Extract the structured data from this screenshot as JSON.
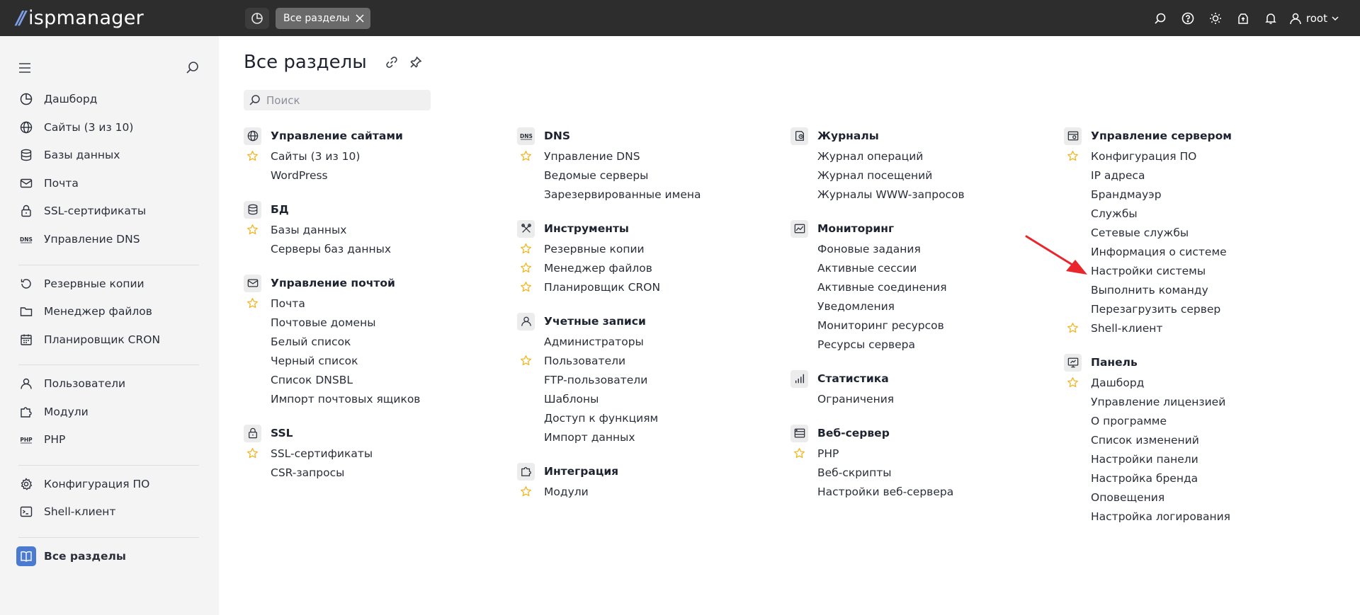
{
  "topbar": {
    "logo_mark": "//",
    "logo_text": "ispmanager",
    "tab_label": "Все разделы",
    "user": "root"
  },
  "sidebar": {
    "items": [
      {
        "label": "Дашборд",
        "icon": "dashboard-icon"
      },
      {
        "label": "Сайты (3 из 10)",
        "icon": "globe-icon"
      },
      {
        "label": "Базы данных",
        "icon": "database-icon"
      },
      {
        "label": "Почта",
        "icon": "mail-icon"
      },
      {
        "label": "SSL-сертификаты",
        "icon": "lock-icon"
      },
      {
        "label": "Управление DNS",
        "icon": "dns-icon"
      },
      {
        "label": "Резервные копии",
        "icon": "backup-icon"
      },
      {
        "label": "Менеджер файлов",
        "icon": "folder-icon"
      },
      {
        "label": "Планировщик CRON",
        "icon": "calendar-icon"
      },
      {
        "label": "Пользователи",
        "icon": "user-icon"
      },
      {
        "label": "Модули",
        "icon": "puzzle-icon"
      },
      {
        "label": "PHP",
        "icon": "php-icon"
      },
      {
        "label": "Конфигурация ПО",
        "icon": "gear-icon"
      },
      {
        "label": "Shell-клиент",
        "icon": "terminal-icon"
      },
      {
        "label": "Все разделы",
        "icon": "book-icon"
      }
    ]
  },
  "main": {
    "title": "Все разделы",
    "search_placeholder": "Поиск",
    "columns": [
      {
        "groups": [
          {
            "title": "Управление сайтами",
            "icon": "globe-icon",
            "links": [
              {
                "label": "Сайты (3 из 10)",
                "starred": true
              },
              {
                "label": "WordPress",
                "starred": false
              }
            ]
          },
          {
            "title": "БД",
            "icon": "database-icon",
            "links": [
              {
                "label": "Базы данных",
                "starred": true
              },
              {
                "label": "Серверы баз данных",
                "starred": false
              }
            ]
          },
          {
            "title": "Управление почтой",
            "icon": "mail-icon",
            "links": [
              {
                "label": "Почта",
                "starred": true
              },
              {
                "label": "Почтовые домены",
                "starred": false
              },
              {
                "label": "Белый список",
                "starred": false
              },
              {
                "label": "Черный список",
                "starred": false
              },
              {
                "label": "Список DNSBL",
                "starred": false
              },
              {
                "label": "Импорт почтовых ящиков",
                "starred": false
              }
            ]
          },
          {
            "title": "SSL",
            "icon": "lock-icon",
            "links": [
              {
                "label": "SSL-сертификаты",
                "starred": true
              },
              {
                "label": "CSR-запросы",
                "starred": false
              }
            ]
          }
        ]
      },
      {
        "groups": [
          {
            "title": "DNS",
            "icon": "dns-icon",
            "links": [
              {
                "label": "Управление DNS",
                "starred": true
              },
              {
                "label": "Ведомые серверы",
                "starred": false
              },
              {
                "label": "Зарезервированные имена",
                "starred": false
              }
            ]
          },
          {
            "title": "Инструменты",
            "icon": "tools-icon",
            "links": [
              {
                "label": "Резервные копии",
                "starred": true
              },
              {
                "label": "Менеджер файлов",
                "starred": true
              },
              {
                "label": "Планировщик CRON",
                "starred": true
              }
            ]
          },
          {
            "title": "Учетные записи",
            "icon": "user-icon",
            "links": [
              {
                "label": "Администраторы",
                "starred": false
              },
              {
                "label": "Пользователи",
                "starred": true
              },
              {
                "label": "FTP-пользователи",
                "starred": false
              },
              {
                "label": "Шаблоны",
                "starred": false
              },
              {
                "label": "Доступ к функциям",
                "starred": false
              },
              {
                "label": "Импорт данных",
                "starred": false
              }
            ]
          },
          {
            "title": "Интеграция",
            "icon": "puzzle-icon",
            "links": [
              {
                "label": "Модули",
                "starred": true
              }
            ]
          }
        ]
      },
      {
        "groups": [
          {
            "title": "Журналы",
            "icon": "log-icon",
            "links": [
              {
                "label": "Журнал операций",
                "starred": false
              },
              {
                "label": "Журнал посещений",
                "starred": false
              },
              {
                "label": "Журналы WWW-запросов",
                "starred": false
              }
            ]
          },
          {
            "title": "Мониторинг",
            "icon": "monitoring-icon",
            "links": [
              {
                "label": "Фоновые задания",
                "starred": false
              },
              {
                "label": "Активные сессии",
                "starred": false
              },
              {
                "label": "Активные соединения",
                "starred": false
              },
              {
                "label": "Уведомления",
                "starred": false
              },
              {
                "label": "Мониторинг ресурсов",
                "starred": false
              },
              {
                "label": "Ресурсы сервера",
                "starred": false
              }
            ]
          },
          {
            "title": "Статистика",
            "icon": "stats-icon",
            "links": [
              {
                "label": "Ограничения",
                "starred": false
              }
            ]
          },
          {
            "title": "Веб-сервер",
            "icon": "webserver-icon",
            "links": [
              {
                "label": "PHP",
                "starred": true
              },
              {
                "label": "Веб-скрипты",
                "starred": false
              },
              {
                "label": "Настройки веб-сервера",
                "starred": false
              }
            ]
          }
        ]
      },
      {
        "groups": [
          {
            "title": "Управление сервером",
            "icon": "server-icon",
            "links": [
              {
                "label": "Конфигурация ПО",
                "starred": true
              },
              {
                "label": "IP адреса",
                "starred": false
              },
              {
                "label": "Брандмауэр",
                "starred": false
              },
              {
                "label": "Службы",
                "starred": false
              },
              {
                "label": "Сетевые службы",
                "starred": false
              },
              {
                "label": "Информация о системе",
                "starred": false
              },
              {
                "label": "Настройки системы",
                "starred": false
              },
              {
                "label": "Выполнить команду",
                "starred": false
              },
              {
                "label": "Перезагрузить сервер",
                "starred": false
              },
              {
                "label": "Shell-клиент",
                "starred": true
              }
            ]
          },
          {
            "title": "Панель",
            "icon": "panel-icon",
            "links": [
              {
                "label": "Дашборд",
                "starred": true
              },
              {
                "label": "Управление лицензией",
                "starred": false
              },
              {
                "label": "О программе",
                "starred": false
              },
              {
                "label": "Список изменений",
                "starred": false
              },
              {
                "label": "Настройки панели",
                "starred": false
              },
              {
                "label": "Настройка бренда",
                "starred": false
              },
              {
                "label": "Оповещения",
                "starred": false
              },
              {
                "label": "Настройка логирования",
                "starred": false
              }
            ]
          }
        ]
      }
    ]
  },
  "colors": {
    "topbar_bg": "#2d2d2d",
    "sidebar_bg": "#f4f4f4",
    "accent": "#4a7bd0",
    "star": "#f2b51f",
    "annotation_arrow": "#e8262b"
  }
}
